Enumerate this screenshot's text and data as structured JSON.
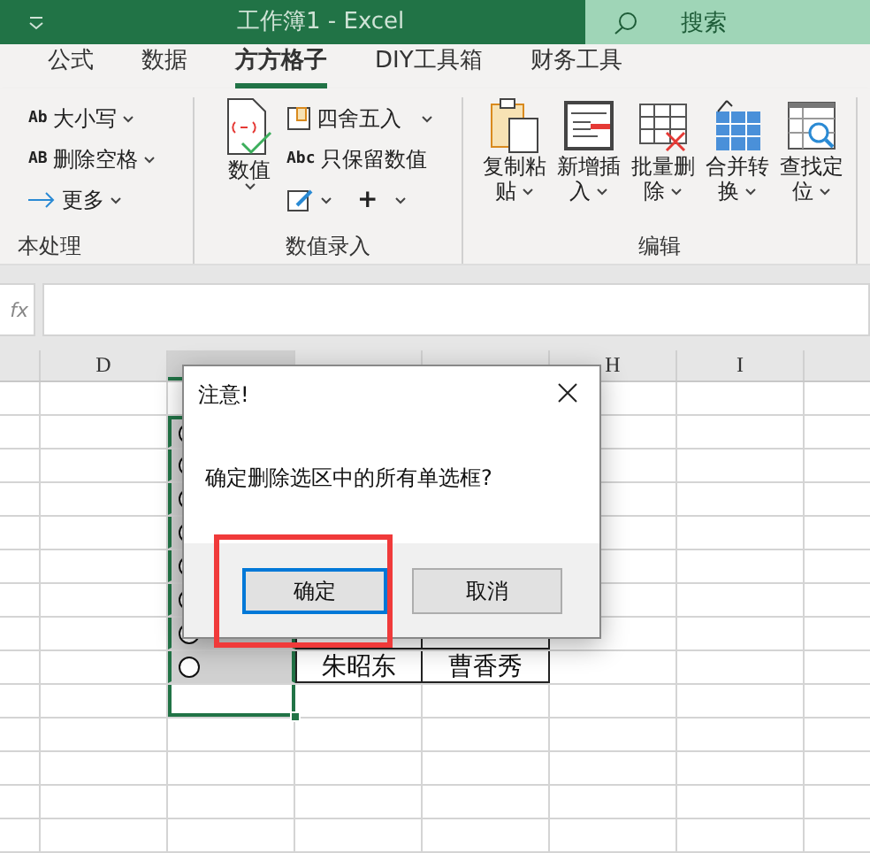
{
  "window": {
    "title": "工作簿1  -  Excel"
  },
  "search": {
    "placeholder": "搜索"
  },
  "tabs": [
    {
      "label": "公式",
      "selected": false
    },
    {
      "label": "数据",
      "selected": false
    },
    {
      "label": "方方格子",
      "selected": true
    },
    {
      "label": "DIY工具箱",
      "selected": false
    },
    {
      "label": "财务工具",
      "selected": false
    }
  ],
  "ribbon": {
    "groups": [
      {
        "kind": "small",
        "label": "本处理",
        "items": [
          {
            "icon_text": "Ab",
            "label": "大小写"
          },
          {
            "icon_text": "AB",
            "label": "删除空格"
          },
          {
            "label": "更多"
          }
        ]
      },
      {
        "kind": "mixed",
        "label": "数值录入",
        "large": {
          "label": "数值"
        },
        "items": [
          {
            "label": "四舍五入"
          },
          {
            "icon_text": "Abc",
            "label": "只保留数值"
          }
        ],
        "extra": [
          "+"
        ]
      },
      {
        "kind": "large",
        "label": "编辑",
        "items": [
          {
            "lines": [
              "复制粘",
              "贴"
            ]
          },
          {
            "lines": [
              "新增插",
              "入"
            ]
          },
          {
            "lines": [
              "批量删",
              "除"
            ]
          },
          {
            "lines": [
              "合并转",
              "换"
            ]
          },
          {
            "lines": [
              "查找定",
              "位"
            ]
          }
        ]
      }
    ]
  },
  "formula_bar": {
    "fx": "fx"
  },
  "sheet": {
    "columns": [
      {
        "label": "D",
        "selected": false
      },
      {
        "selected": true
      },
      {
        "selected": false
      },
      {
        "selected": false
      },
      {
        "label": "H",
        "selected": false
      },
      {
        "label": "I",
        "selected": false
      }
    ],
    "rows": [
      {
        "selected": true,
        "radio": true
      },
      {
        "selected": true,
        "radio": true
      },
      {
        "selected": true,
        "radio": true
      },
      {
        "selected": true,
        "radio": true
      },
      {
        "selected": true,
        "radio": true
      },
      {
        "selected": true,
        "radio": true
      },
      {
        "selected": true,
        "radio": true,
        "table": true
      },
      {
        "selected": true,
        "radio": true,
        "table": true,
        "f": "朱昭东",
        "g": "曹香秀"
      },
      {
        "selected": true,
        "radio": false,
        "table": false
      },
      {
        "selected": false,
        "radio": false,
        "table": false
      },
      {
        "selected": false,
        "radio": false,
        "table": false
      },
      {
        "selected": false,
        "radio": false,
        "table": false
      },
      {
        "selected": false,
        "radio": false,
        "table": false
      }
    ]
  },
  "dialog": {
    "title": "注意!",
    "message": "确定删除选区中的所有单选框?",
    "buttons": [
      {
        "label": "确定",
        "focused": true
      },
      {
        "label": "取消",
        "focused": false
      }
    ],
    "highlight": true
  }
}
